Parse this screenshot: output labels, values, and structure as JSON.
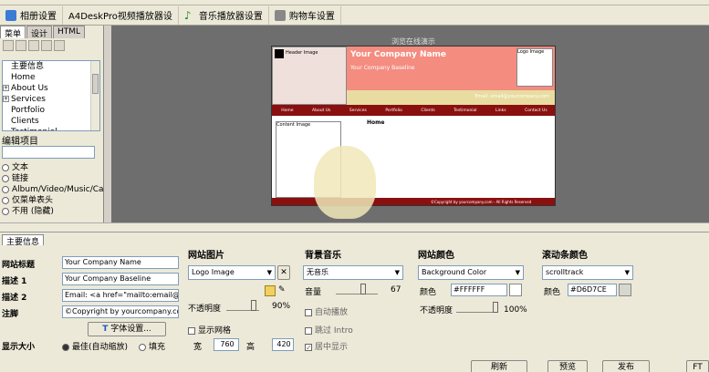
{
  "toolbar": {
    "album": "相册设置",
    "video": "A4DeskPro视频播放器设",
    "music": "音乐播放器设置",
    "cart": "购物车设置"
  },
  "left_panel": {
    "tabs": [
      "菜单",
      "设计",
      "HTML"
    ],
    "tree": [
      {
        "label": "主要信息",
        "expandable": false
      },
      {
        "label": "Home",
        "expandable": false
      },
      {
        "label": "About Us",
        "expandable": true
      },
      {
        "label": "Services",
        "expandable": true
      },
      {
        "label": "Portfolio",
        "expandable": false
      },
      {
        "label": "Clients",
        "expandable": false
      },
      {
        "label": "Testimonial",
        "expandable": false
      }
    ],
    "edit_label": "编辑项目",
    "radios": [
      "文本",
      "链接",
      "Album/Video/Music/Cart",
      "仅菜单表头",
      "不用 (隐藏)"
    ]
  },
  "preview": {
    "top_title": "浏览在线演示",
    "company": "Your Company Name",
    "baseline": "Your Company Baseline",
    "logo": "Logo Image",
    "header_img": "Header Image",
    "email": "Email: email@yourcompany.com",
    "nav": [
      "Home",
      "About Us",
      "Services",
      "Portfolio",
      "Clients",
      "Testimonial",
      "Links",
      "Contact Us"
    ],
    "content_img": "Content Image",
    "home": "Home",
    "footer": "©Copyright by yourcompany.com - All Rights Reserved"
  },
  "bottom": {
    "tab": "主要信息",
    "site_title_label": "网站标题",
    "desc1_label": "描述 1",
    "desc2_label": "描述 2",
    "footer_label": "注脚",
    "title_value": "Your Company Name",
    "desc1_value": "Your Company Baseline",
    "desc2_value": "Email: <a href=\"mailto:email@yourc",
    "footer_value": "©Copyright by yourcompany.com .",
    "font_btn": "字体设置...",
    "display_label": "显示大小",
    "best_fit": "最佳(自动缩放)",
    "fill": "填充",
    "images_section": "网站图片",
    "images_dd": "Logo Image",
    "opacity_label": "不透明度",
    "opacity_val": "90%",
    "show_grid": "显示网格",
    "width_label": "宽",
    "width_val": "760",
    "height_label": "高",
    "height_val": "420",
    "music_section": "背景音乐",
    "music_dd": "无音乐",
    "volume_label": "音量",
    "volume_val": "67",
    "autoplay": "自动播放",
    "skip_intro": "跳过 Intro",
    "center_display": "居中显示",
    "color_section": "网站颜色",
    "color_dd": "Background Color",
    "color_label": "颜色",
    "color_hex": "#FFFFFF",
    "color_opacity_label": "不透明度",
    "color_opacity_val": "100%",
    "scroll_section": "滚动条颜色",
    "scroll_dd": "scrolltrack",
    "scroll_color_label": "颜色",
    "scroll_hex": "#D6D7CE",
    "refresh": "刷新",
    "preview_btn": "预览",
    "publish": "发布",
    "ftp": "FT"
  },
  "colors": {
    "header_pink": "#f48c80",
    "navbar": "#8a1010",
    "scroll_swatch": "#D6D7CE"
  },
  "opacity_fraction": 0.9,
  "color_opacity_fraction": 1.0,
  "volume_fraction": 0.67
}
